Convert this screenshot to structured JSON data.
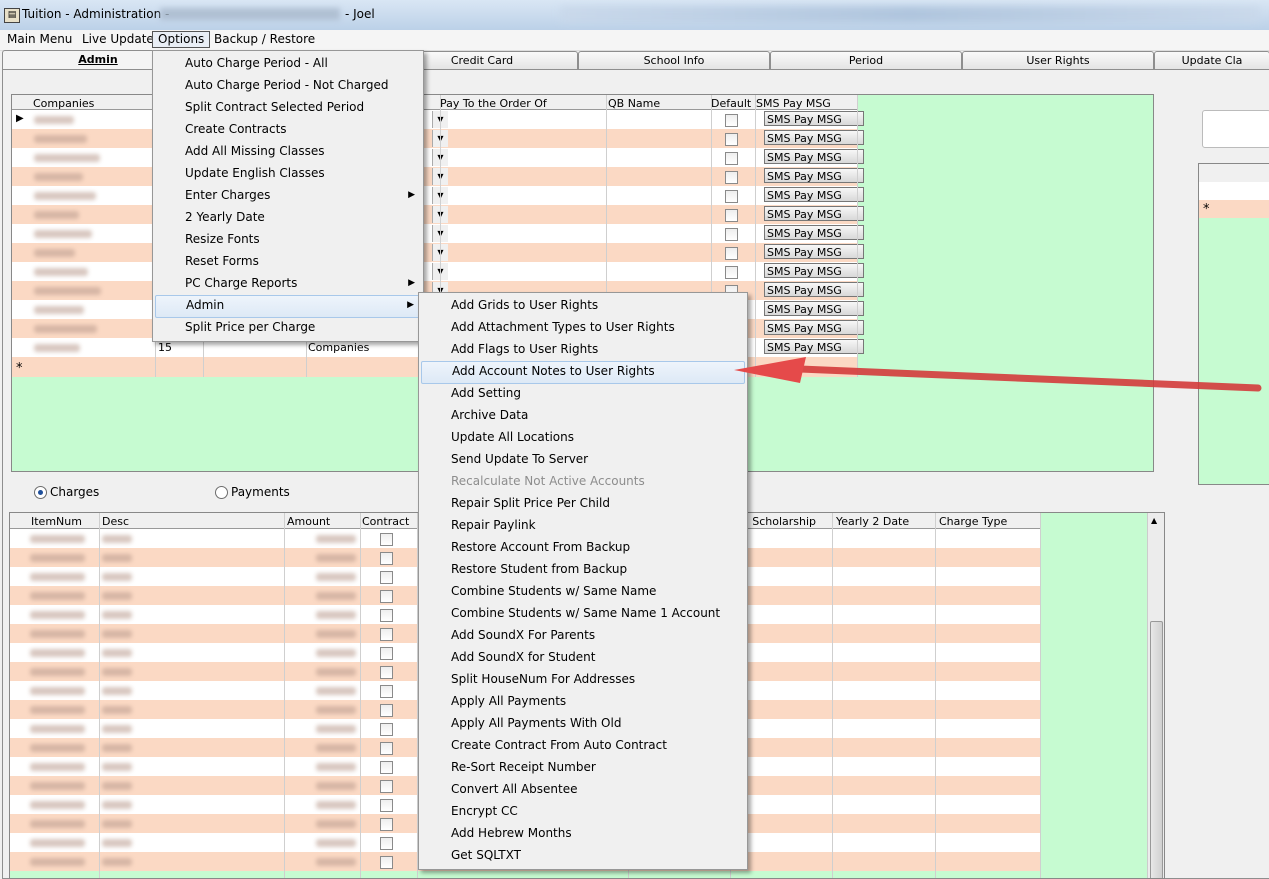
{
  "window": {
    "title": "Tuition - Administration -",
    "user": "- Joel"
  },
  "menubar": [
    "Main Menu",
    "Live Update",
    "Options",
    "Backup / Restore"
  ],
  "tabs": [
    "Admin",
    "Credit Card",
    "School Info",
    "Period",
    "User Rights",
    "Update Cla"
  ],
  "companies_grid": {
    "headers": [
      "Companies",
      "Pay To the Order Of",
      "QB Name",
      "Default",
      "SMS Pay MSG"
    ],
    "sms_button_label": "SMS Pay MSG",
    "last_row_num": "15",
    "last_row_type": "Companies",
    "new_row_marker": "*",
    "current_row_marker": "▶"
  },
  "right_grid": {
    "new_row_marker": "*"
  },
  "radios": {
    "charges": "Charges",
    "payments": "Payments",
    "selected": "charges"
  },
  "charges_grid": {
    "headers": [
      "ItemNum",
      "Desc",
      "Amount",
      "Contract",
      "m Scholarship",
      "Yearly 2 Date",
      "Charge Type"
    ]
  },
  "options_menu": [
    {
      "label": "Auto Charge Period - All"
    },
    {
      "label": "Auto Charge Period - Not Charged"
    },
    {
      "label": "Split Contract Selected Period"
    },
    {
      "label": "Create Contracts"
    },
    {
      "label": "Add All Missing Classes"
    },
    {
      "label": "Update English Classes"
    },
    {
      "label": "Enter Charges",
      "submenu": true
    },
    {
      "label": "2 Yearly Date"
    },
    {
      "label": "Resize Fonts"
    },
    {
      "label": "Reset Forms"
    },
    {
      "label": "PC Charge Reports",
      "submenu": true
    },
    {
      "label": "Admin",
      "submenu": true,
      "highlighted": true
    },
    {
      "label": "Split Price per Charge"
    }
  ],
  "admin_submenu": [
    {
      "label": "Add Grids to User Rights"
    },
    {
      "label": "Add Attachment Types to User Rights"
    },
    {
      "label": "Add Flags to User Rights"
    },
    {
      "label": "Add Account Notes to User Rights",
      "highlighted": true
    },
    {
      "label": "Add Setting"
    },
    {
      "label": "Archive Data"
    },
    {
      "label": "Update All Locations"
    },
    {
      "label": "Send Update To Server"
    },
    {
      "label": "Recalculate Not Active Accounts",
      "disabled": true
    },
    {
      "label": "Repair Split Price Per Child"
    },
    {
      "label": "Repair Paylink"
    },
    {
      "label": "Restore Account From Backup"
    },
    {
      "label": "Restore Student from Backup"
    },
    {
      "label": "Combine Students w/ Same Name"
    },
    {
      "label": "Combine Students w/ Same Name 1 Account"
    },
    {
      "label": "Add SoundX For Parents"
    },
    {
      "label": "Add SoundX for Student"
    },
    {
      "label": "Split HouseNum For Addresses"
    },
    {
      "label": "Apply All Payments"
    },
    {
      "label": "Apply All Payments With Old"
    },
    {
      "label": "Create Contract From Auto Contract"
    },
    {
      "label": "Re-Sort Receipt Number"
    },
    {
      "label": "Convert All Absentee"
    },
    {
      "label": "Encrypt CC"
    },
    {
      "label": "Add Hebrew Months"
    },
    {
      "label": "Get SQLTXT"
    }
  ],
  "colors": {
    "grid_bg": "#c6fbd1",
    "row_alt": "#fbd9c4",
    "arrow": "#e84a4a"
  }
}
